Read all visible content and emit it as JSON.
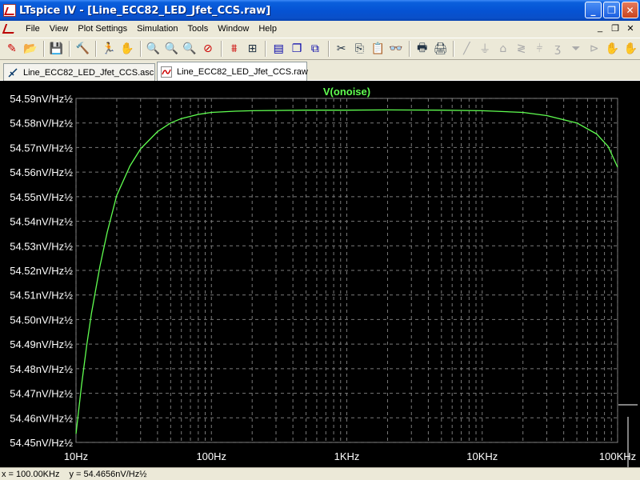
{
  "window": {
    "title": "LTspice IV - [Line_ECC82_LED_Jfet_CCS.raw]",
    "buttons": {
      "minimize": "_",
      "restore": "❐",
      "close": "✕"
    }
  },
  "menu": {
    "items": [
      {
        "label": "File"
      },
      {
        "label": "View"
      },
      {
        "label": "Plot Settings"
      },
      {
        "label": "Simulation"
      },
      {
        "label": "Tools"
      },
      {
        "label": "Window"
      },
      {
        "label": "Help"
      }
    ],
    "mdi_buttons": {
      "minimize": "_",
      "restore": "❐",
      "close": "✕"
    }
  },
  "toolbar": {
    "icons": [
      "new-schematic-icon",
      "open-icon",
      "save-icon",
      "control-panel-icon",
      "run-icon",
      "halt-icon",
      "zoom-in-icon",
      "zoom-out-icon",
      "zoom-fit-icon",
      "zoom-cancel-icon",
      "autorange-icon",
      "fit-icon",
      "tile-horizontal-icon",
      "cascade-icon",
      "close-window-icon",
      "cut-icon",
      "copy-icon",
      "paste-icon",
      "find-icon",
      "print-preview-icon",
      "print-icon",
      "wire-icon",
      "ground-icon",
      "label-icon",
      "resistor-icon",
      "capacitor-icon",
      "inductor-icon",
      "diode-icon",
      "component-icon",
      "move-icon",
      "drag-icon"
    ]
  },
  "tabs": [
    {
      "label": "Line_ECC82_LED_Jfet_CCS.asc",
      "active": false
    },
    {
      "label": "Line_ECC82_LED_Jfet_CCS.raw",
      "active": true
    }
  ],
  "chart_data": {
    "type": "line",
    "title": "V(onoise)",
    "x_scale": "log",
    "xlim": [
      10,
      100000
    ],
    "ylim": [
      54.45,
      54.59
    ],
    "x_tick_labels": [
      "10Hz",
      "100Hz",
      "1KHz",
      "10KHz",
      "100KHz"
    ],
    "y_tick_labels": [
      "54.59nV/Hz½",
      "54.58nV/Hz½",
      "54.57nV/Hz½",
      "54.56nV/Hz½",
      "54.55nV/Hz½",
      "54.54nV/Hz½",
      "54.53nV/Hz½",
      "54.52nV/Hz½",
      "54.51nV/Hz½",
      "54.50nV/Hz½",
      "54.49nV/Hz½",
      "54.48nV/Hz½",
      "54.47nV/Hz½",
      "54.46nV/Hz½",
      "54.45nV/Hz½"
    ],
    "grid": true,
    "series": [
      {
        "name": "V(onoise)",
        "color": "#60ff50",
        "x": [
          10,
          11,
          12,
          13,
          15,
          17,
          20,
          25,
          30,
          40,
          50,
          60,
          80,
          100,
          150,
          200,
          500,
          1000,
          2000,
          5000,
          10000,
          20000,
          30000,
          50000,
          70000,
          85000,
          100000
        ],
        "y": [
          54.4535,
          54.4735,
          54.4895,
          54.5025,
          54.5215,
          54.5355,
          54.5505,
          54.5625,
          54.5695,
          54.5765,
          54.58,
          54.5818,
          54.5835,
          54.5843,
          54.5848,
          54.585,
          54.5852,
          54.5852,
          54.5853,
          54.5852,
          54.585,
          54.5843,
          54.583,
          54.58,
          54.5755,
          54.5705,
          54.562
        ]
      }
    ]
  },
  "status": {
    "x_readout": "x = 100.00KHz",
    "y_readout": "y = 54.4656nV/Hz½"
  }
}
